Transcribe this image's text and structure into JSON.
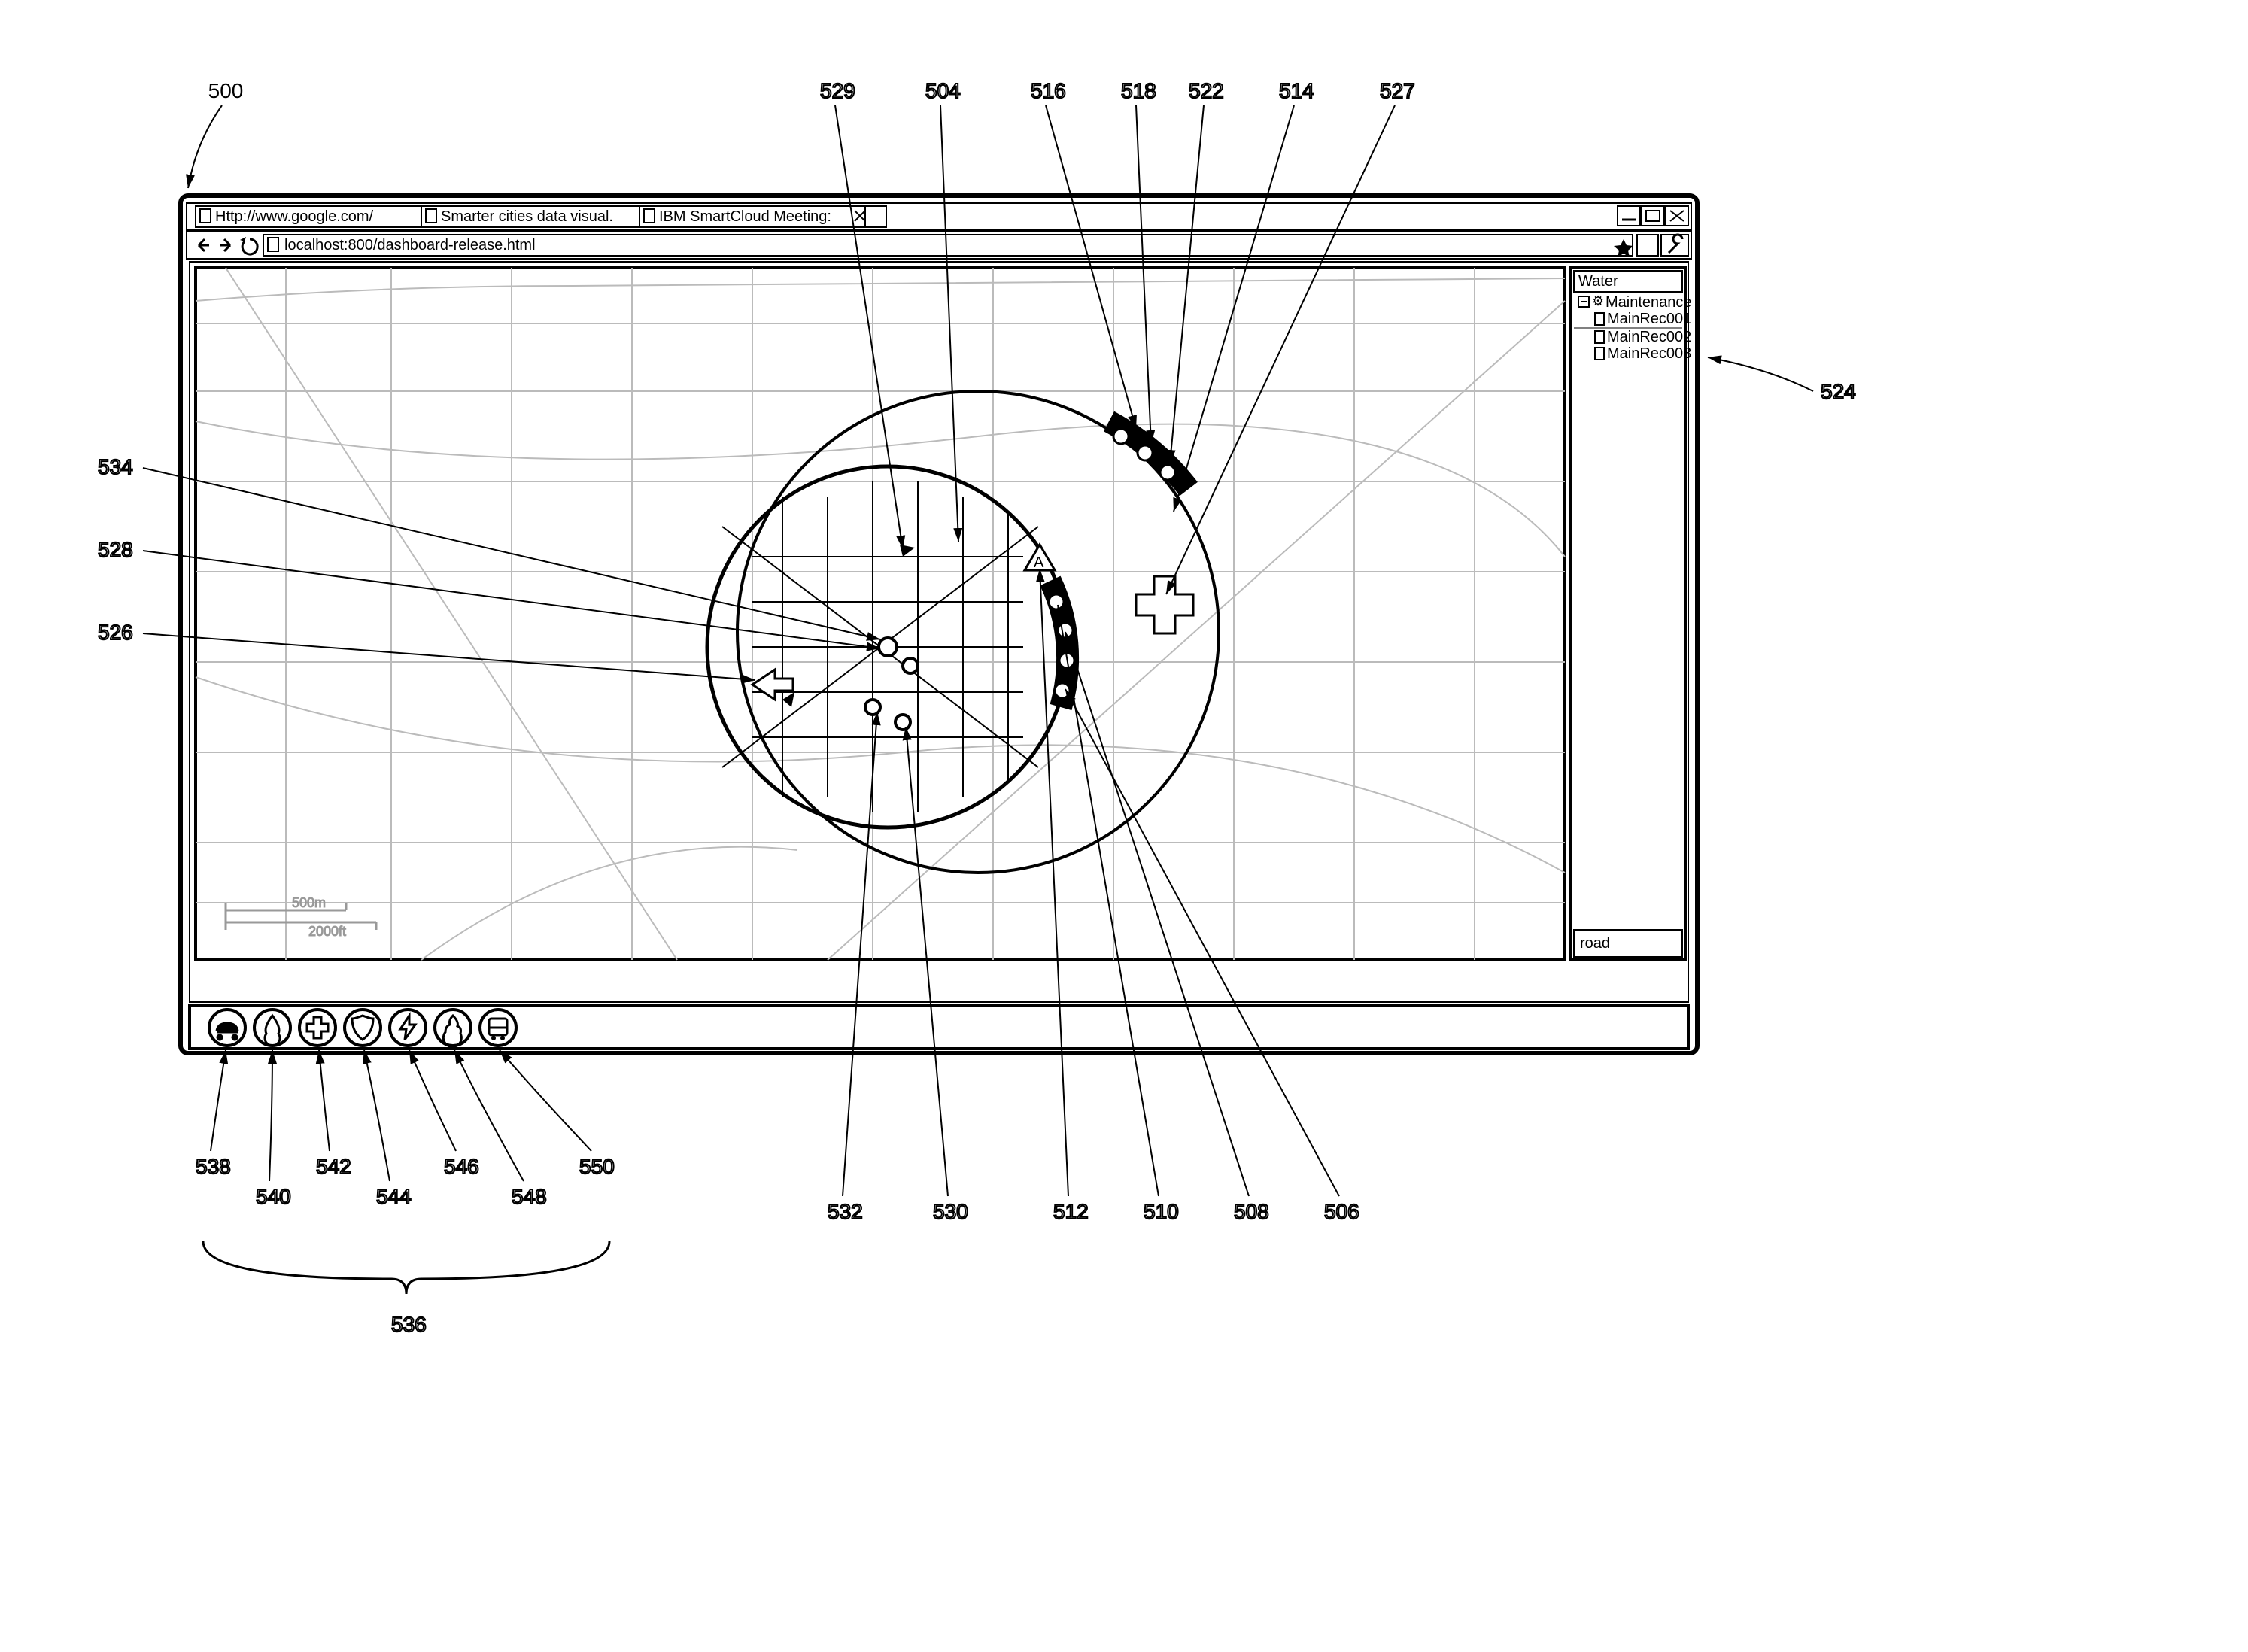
{
  "figure_ref": "500",
  "browser": {
    "tabs": [
      {
        "label": "Http://www.google.com/"
      },
      {
        "label": "Smarter cities data visual."
      },
      {
        "label": "IBM SmartCloud Meeting:"
      }
    ],
    "address": "localhost:800/dashboard-release.html"
  },
  "sidebar": {
    "title": "Water",
    "group_label": "Maintenance",
    "items": [
      "MainRec001",
      "MainRec002",
      "MainRec003"
    ],
    "footer": "road"
  },
  "scale": {
    "metric": "500m",
    "imperial": "2000ft"
  },
  "toolbar": {
    "icons": [
      {
        "name": "car-icon",
        "ref": "538"
      },
      {
        "name": "drop-icon",
        "ref": "540"
      },
      {
        "name": "medical-icon",
        "ref": "542"
      },
      {
        "name": "shield-icon",
        "ref": "544"
      },
      {
        "name": "bolt-icon",
        "ref": "546"
      },
      {
        "name": "flame-icon",
        "ref": "548"
      },
      {
        "name": "bus-icon",
        "ref": "550"
      }
    ],
    "group_ref": "536"
  },
  "callouts": {
    "top": [
      {
        "ref": "529",
        "target": "circle-inner"
      },
      {
        "ref": "504",
        "target": "circle-outer"
      },
      {
        "ref": "516",
        "target": "arc-outer"
      },
      {
        "ref": "518",
        "target": "arc-dot-1"
      },
      {
        "ref": "522",
        "target": "arc-dot-2"
      },
      {
        "ref": "514",
        "target": "circle-right"
      },
      {
        "ref": "527",
        "target": "cross-poi"
      }
    ],
    "left": [
      {
        "ref": "534",
        "target": "center-dot"
      },
      {
        "ref": "528",
        "target": "center-dot"
      },
      {
        "ref": "526",
        "target": "arrow-poi"
      }
    ],
    "bottom_row": [
      "532",
      "530",
      "512",
      "510",
      "508",
      "506"
    ],
    "sidebar_ref": "524"
  }
}
